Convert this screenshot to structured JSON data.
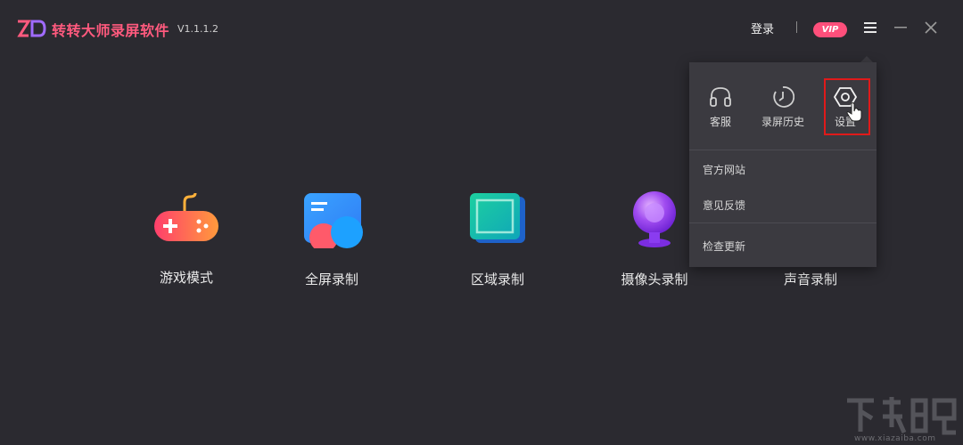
{
  "app": {
    "title": "转转大师录屏软件",
    "version": "V1.1.1.2"
  },
  "header": {
    "login_label": "登录",
    "vip_label": "VIP"
  },
  "modes": [
    {
      "label": "游戏模式",
      "icon": "gamepad-icon"
    },
    {
      "label": "全屏录制",
      "icon": "fullscreen-icon"
    },
    {
      "label": "区域录制",
      "icon": "region-icon"
    },
    {
      "label": "摄像头录制",
      "icon": "webcam-icon"
    },
    {
      "label": "声音录制",
      "icon": "audio-icon"
    }
  ],
  "menu": {
    "icon_items": [
      {
        "label": "客服",
        "icon": "headset-icon"
      },
      {
        "label": "录屏历史",
        "icon": "clock-icon"
      },
      {
        "label": "设置",
        "icon": "settings-icon"
      }
    ],
    "items": [
      "官方网站",
      "意见反馈",
      "检查更新"
    ]
  },
  "watermark": {
    "url": "www.xiazaiba.com"
  },
  "colors": {
    "background": "#2b2a30",
    "accent": "#ff4f7b",
    "menu_bg": "#3b3a40",
    "highlight": "#e01a1a"
  }
}
